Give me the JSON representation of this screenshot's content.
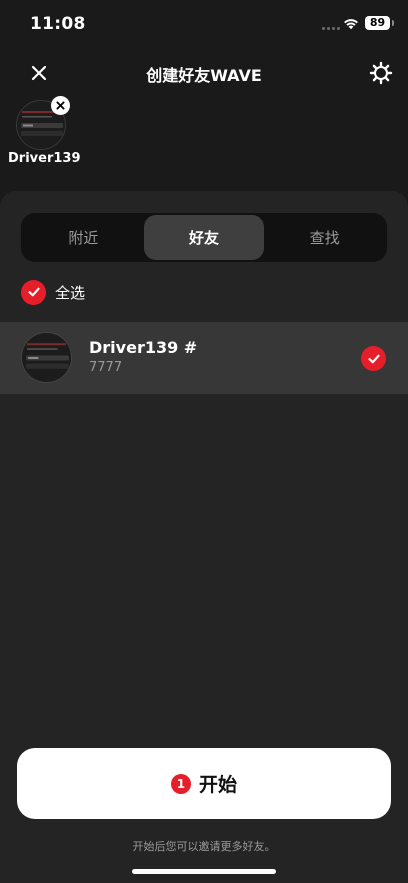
{
  "status_bar": {
    "time": "11:08",
    "battery": "89"
  },
  "header": {
    "title": "创建好友WAVE",
    "close_icon": "close-icon",
    "settings_icon": "gear-icon"
  },
  "selected_friends": [
    {
      "name": "Driver139"
    }
  ],
  "tabs": [
    {
      "label": "附近",
      "active": false
    },
    {
      "label": "好友",
      "active": true
    },
    {
      "label": "查找",
      "active": false
    }
  ],
  "select_all": {
    "label": "全选",
    "checked": true
  },
  "friends": [
    {
      "name": "Driver139 #",
      "sub": "7777",
      "checked": true
    }
  ],
  "start_button": {
    "count": "1",
    "label": "开始"
  },
  "hint": "开始后您可以邀请更多好友。",
  "colors": {
    "accent": "#e61e2a",
    "background": "#1a1a1a",
    "sheet": "#242424",
    "row_selected": "#373737"
  }
}
